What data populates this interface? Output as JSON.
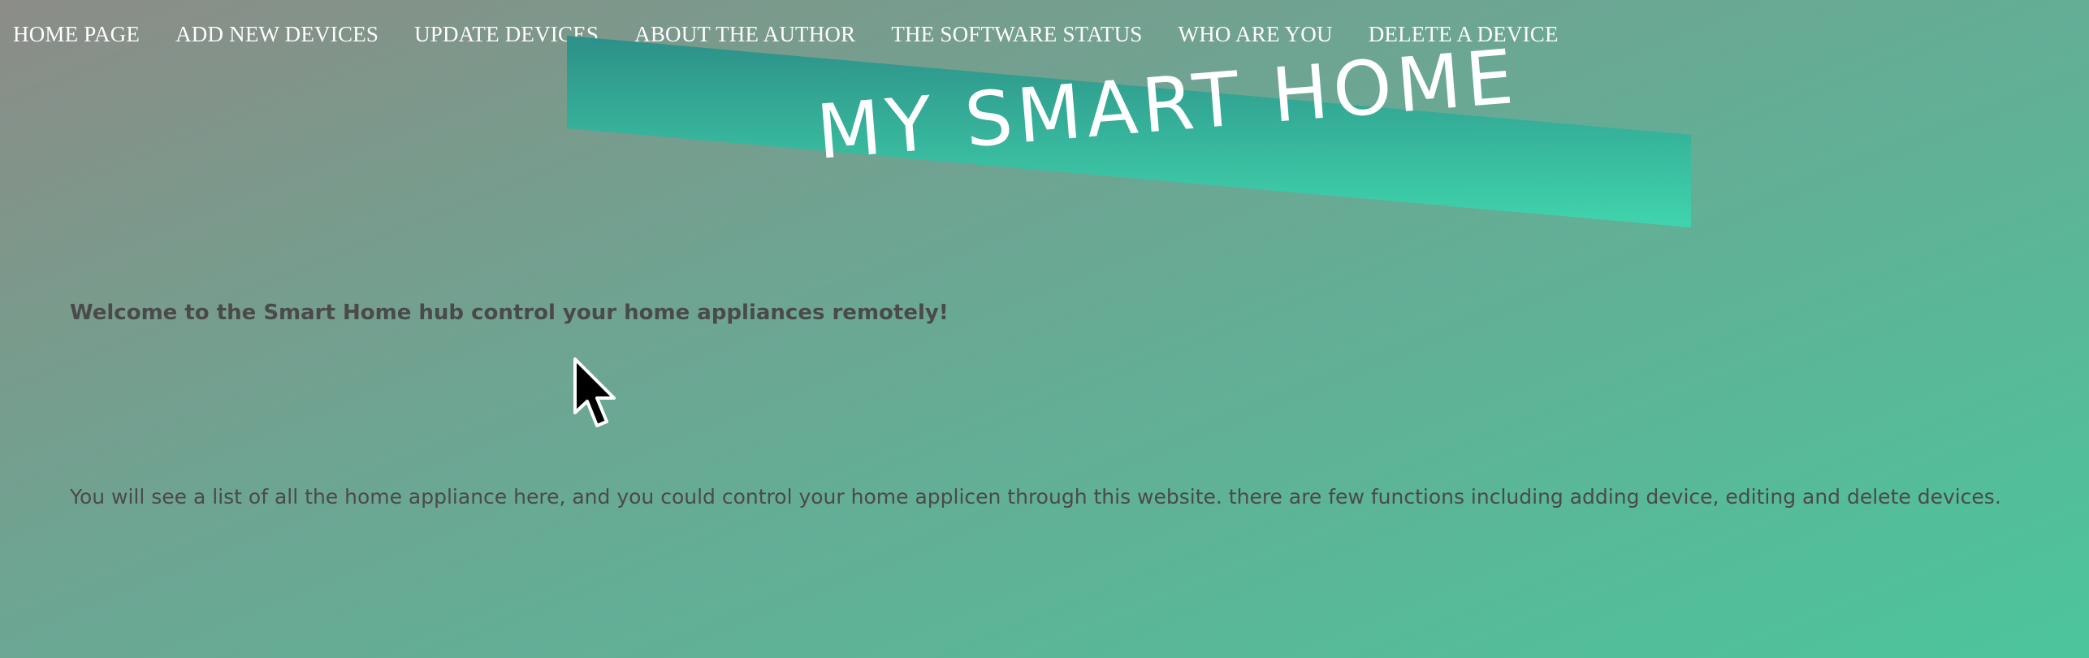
{
  "nav": {
    "items": [
      {
        "label": "HOME PAGE"
      },
      {
        "label": "ADD NEW DEVICES"
      },
      {
        "label": "UPDATE DEVICES"
      },
      {
        "label": "ABOUT THE AUTHOR"
      },
      {
        "label": "THE SOFTWARE STATUS"
      },
      {
        "label": "WHO ARE YOU"
      },
      {
        "label": "DELETE A DEVICE"
      }
    ]
  },
  "banner": {
    "title": "MY SMART HOME",
    "colors": {
      "banner_top": "#2a8f88",
      "banner_bottom": "#3fd6ad",
      "title_text": "#ffffff"
    }
  },
  "main": {
    "welcome": "Welcome to the Smart Home hub control your home appliances remotely!",
    "description": "You will see a list of all the home appliance here, and you could control your home applicen through this website. there are few functions including adding device, editing and delete devices."
  },
  "colors": {
    "background_start": "#8c8c88",
    "background_end": "#4cc59c",
    "nav_text": "#ffffff",
    "body_text": "#4a4a4a"
  },
  "cursor": {
    "icon": "arrow-pointer-icon"
  }
}
